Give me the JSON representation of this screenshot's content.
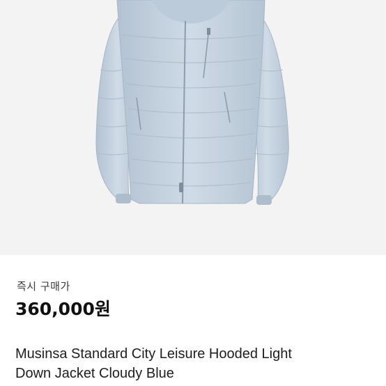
{
  "product": {
    "image_alt": "Light blue hooded down jacket",
    "buy_type": "즉시 구매가",
    "price": "360,000원",
    "title_line1": "Musinsa Standard City Leisure Hooded Light",
    "title_line2": "Down Jacket Cloudy Blue",
    "colors": {
      "jacket": "#c5d2df",
      "jacket_shadow": "#a9b8c8",
      "image_background": "#f3f3f3",
      "price_text": "#111111"
    }
  }
}
